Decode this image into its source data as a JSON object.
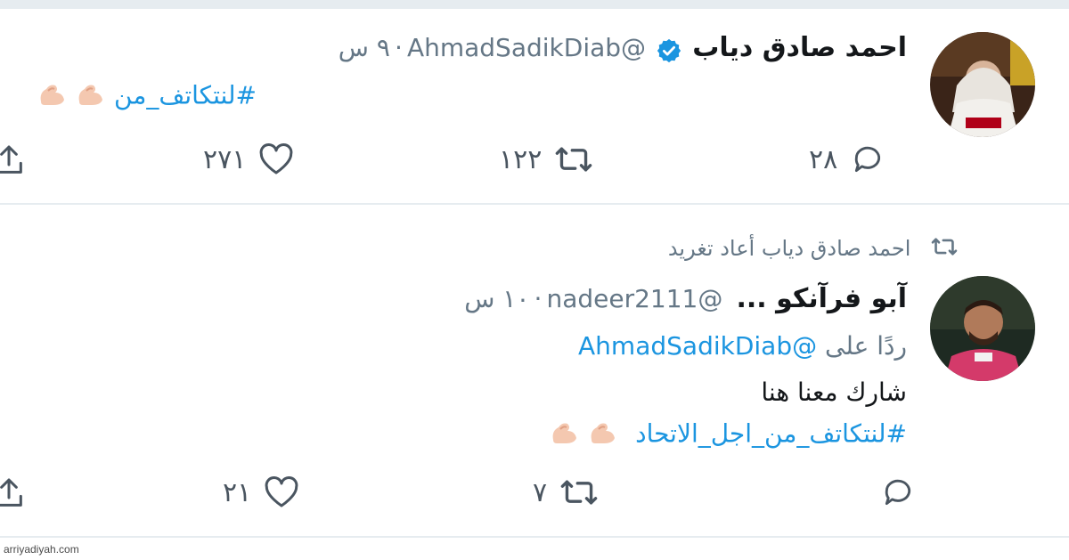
{
  "tweet1": {
    "author_name": "احمد صادق دياب",
    "handle": "@AhmadSadikDiab",
    "separator": "·",
    "time": "٩ س",
    "hashtag": "#لنتكاتف_من",
    "actions": {
      "reply_count": "٢٨",
      "retweet_count": "١٢٢",
      "like_count": "٢٧١"
    }
  },
  "tweet2": {
    "retweet_label": "احمد صادق دياب أعاد تغريد",
    "author_name": "آبو فرآنكو ...",
    "handle": "@nadeer2111",
    "separator": "·",
    "time": "١٠ س",
    "reply_prefix": "ردًا على",
    "reply_to": "@AhmadSadikDiab",
    "text": "شارك معنا هنا",
    "hashtag": "#لنتكاتف_من_اجل_الاتحاد",
    "actions": {
      "reply_count": "",
      "retweet_count": "٧",
      "like_count": "٢١"
    }
  },
  "watermark": "arriyadiyah.com",
  "icons": [
    "reply-icon",
    "retweet-icon",
    "like-icon",
    "share-icon",
    "verified-icon",
    "flexed-biceps-icon"
  ],
  "colors": {
    "link_blue": "#1b95e0",
    "muted_gray": "#657786",
    "divider": "#e6ecf0"
  }
}
